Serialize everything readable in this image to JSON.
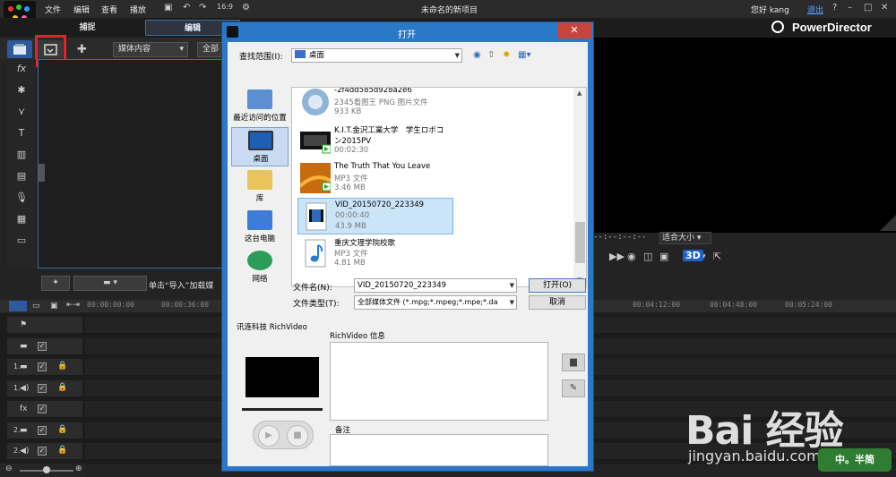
{
  "app": {
    "menu": [
      "文件",
      "编辑",
      "查看",
      "播放"
    ],
    "window_title": "未命名的新项目",
    "greeting": "您好 kang",
    "logout": "退出",
    "controls": [
      "?",
      "–",
      "□",
      "✕"
    ],
    "modes": {
      "capture": "捕捉",
      "edit": "编辑"
    },
    "brand": "PowerDirector",
    "library_filter": "媒体内容",
    "library_filter2": "全部",
    "import_hint": "单击“导入”加载媒",
    "preview_timecode": "--:--:--:--",
    "fit_label": "适合大小",
    "threed_label": "3D"
  },
  "timeline": {
    "ruler": [
      "00:00:00:00",
      "00:00:36:00",
      "00:04:12:00",
      "00:04:48:00",
      "00:05:24:00"
    ],
    "tracks": [
      {
        "num": "",
        "icon": "flag-icon"
      },
      {
        "num": "",
        "icon": "video-icon"
      },
      {
        "num": "1.",
        "icon": "video-icon"
      },
      {
        "num": "1.",
        "icon": "audio-icon"
      },
      {
        "num": "",
        "icon": "fx-icon"
      },
      {
        "num": "2.",
        "icon": "video-icon"
      },
      {
        "num": "2.",
        "icon": "audio-icon"
      },
      {
        "num": "",
        "icon": "title-icon"
      }
    ]
  },
  "dialog": {
    "title": "打开",
    "lookin_label": "查找范围(I):",
    "lookin_value": "桌面",
    "places": [
      {
        "label": "最近访问的位置",
        "icon": "recent-places-icon"
      },
      {
        "label": "桌面",
        "icon": "desktop-icon"
      },
      {
        "label": "库",
        "icon": "library-icon"
      },
      {
        "label": "这台电脑",
        "icon": "computer-icon"
      },
      {
        "label": "网络",
        "icon": "network-icon"
      }
    ],
    "files": [
      {
        "name": "-2f4dd585d928a2e6",
        "type": "2345看图王 PNG 图片文件",
        "size": "933 KB",
        "thumb": "image-thumb"
      },
      {
        "name": "K.I.T.金沢工業大学　学生ロボコ",
        "name2": "ン2015PV",
        "type": "00:02:30",
        "thumb": "video-thumb"
      },
      {
        "name": "The Truth That You Leave",
        "type": "MP3 文件",
        "size": "3.46 MB",
        "thumb": "album-thumb"
      },
      {
        "name": "VID_20150720_223349",
        "type": "00:00:40",
        "size": "43.9 MB",
        "thumb": "video-file-thumb"
      },
      {
        "name": "重庆文理学院校歌",
        "type": "MP3 文件",
        "size": "4.81 MB",
        "thumb": "music-note-thumb"
      }
    ],
    "filename_label": "文件名(N):",
    "filename_value": "VID_20150720_223349",
    "filetype_label": "文件类型(T):",
    "filetype_value": "全部媒体文件 (*.mpg;*.mpeg;*.mpe;*.da",
    "open_button": "打开(O)",
    "cancel_button": "取消",
    "richvideo_title": "讯连科技 RichVideo",
    "info_label": "RichVideo 信息",
    "note_label": "备注"
  },
  "watermark": {
    "text": "Bai 经验",
    "sub": "jingyan.baidu.com",
    "badge": "中。半简"
  },
  "colors": {
    "accent": "#2a78c8",
    "highlight_box": "#e8202a",
    "selected_row": "#cce4f7"
  }
}
